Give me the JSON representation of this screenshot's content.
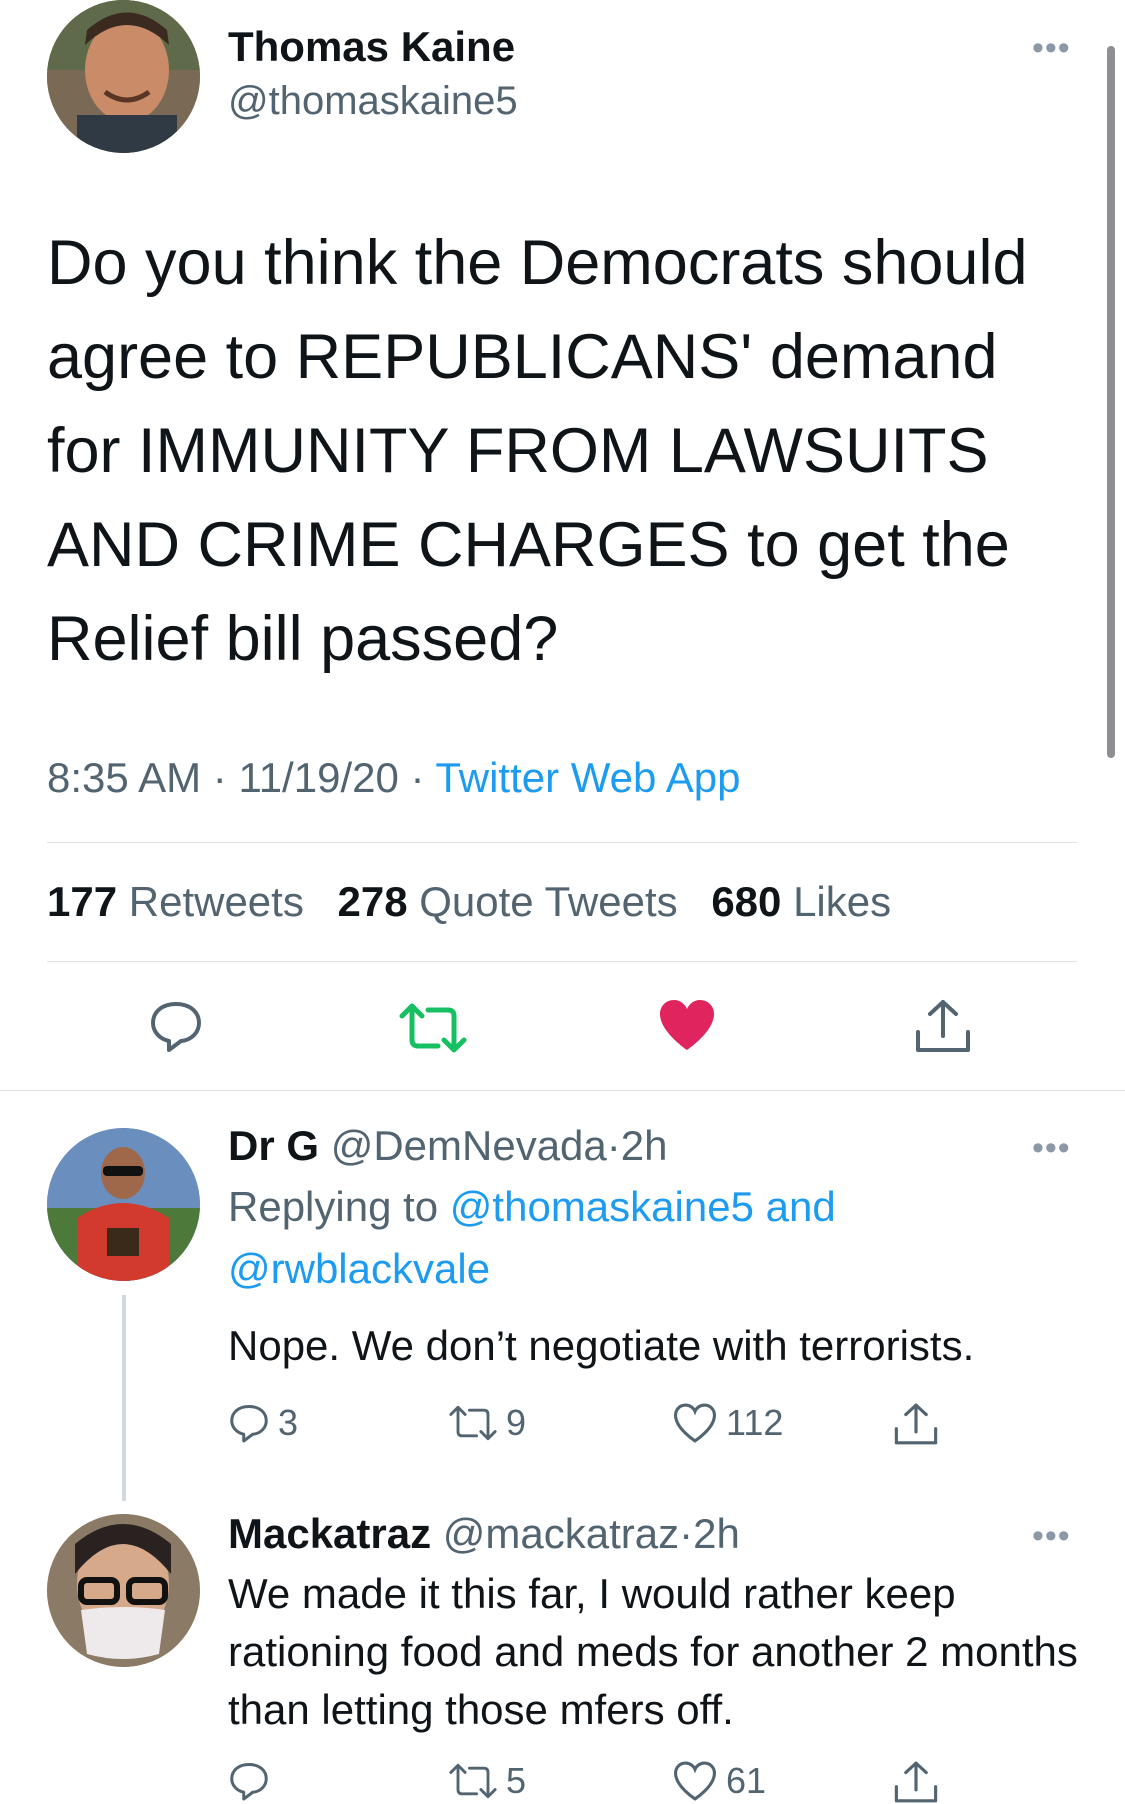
{
  "tweet": {
    "author_name": "Thomas Kaine",
    "author_handle": "@thomaskaine5",
    "text": "Do you think the Democrats should agree to REPUBLICANS' demand for IMMUNITY FROM LAWSUITS AND CRIME CHARGES to get the Relief bill passed?",
    "time": "8:35 AM",
    "date": "11/19/20",
    "source": "Twitter Web App",
    "retweets_count": "177",
    "retweets_label": "Retweets",
    "quotes_count": "278",
    "quotes_label": "Quote Tweets",
    "likes_count": "680",
    "likes_label": "Likes",
    "separator": "·",
    "more_icon": "more-horizontal-icon"
  },
  "replies": [
    {
      "name": "Dr G",
      "handle": "@DemNevada",
      "time": "2h",
      "replying_prefix": "Replying to",
      "replying_user1": "@thomaskaine5",
      "replying_and": "and",
      "replying_user2": "@rwblackvale",
      "text": "Nope. We don’t negotiate with terrorists.",
      "reply_count": "3",
      "retweet_count": "9",
      "like_count": "112"
    },
    {
      "name": "Mackatraz",
      "handle": "@mackatraz",
      "time": "2h",
      "text": "We made it this far, I would rather keep rationing food and meds for another 2 months than letting those mfers off.",
      "retweet_count": "5",
      "like_count": "61"
    }
  ],
  "colors": {
    "link": "#1d9bf0",
    "retweet_active": "#17bf63",
    "like_active": "#e0245e",
    "secondary_text": "#536471"
  }
}
